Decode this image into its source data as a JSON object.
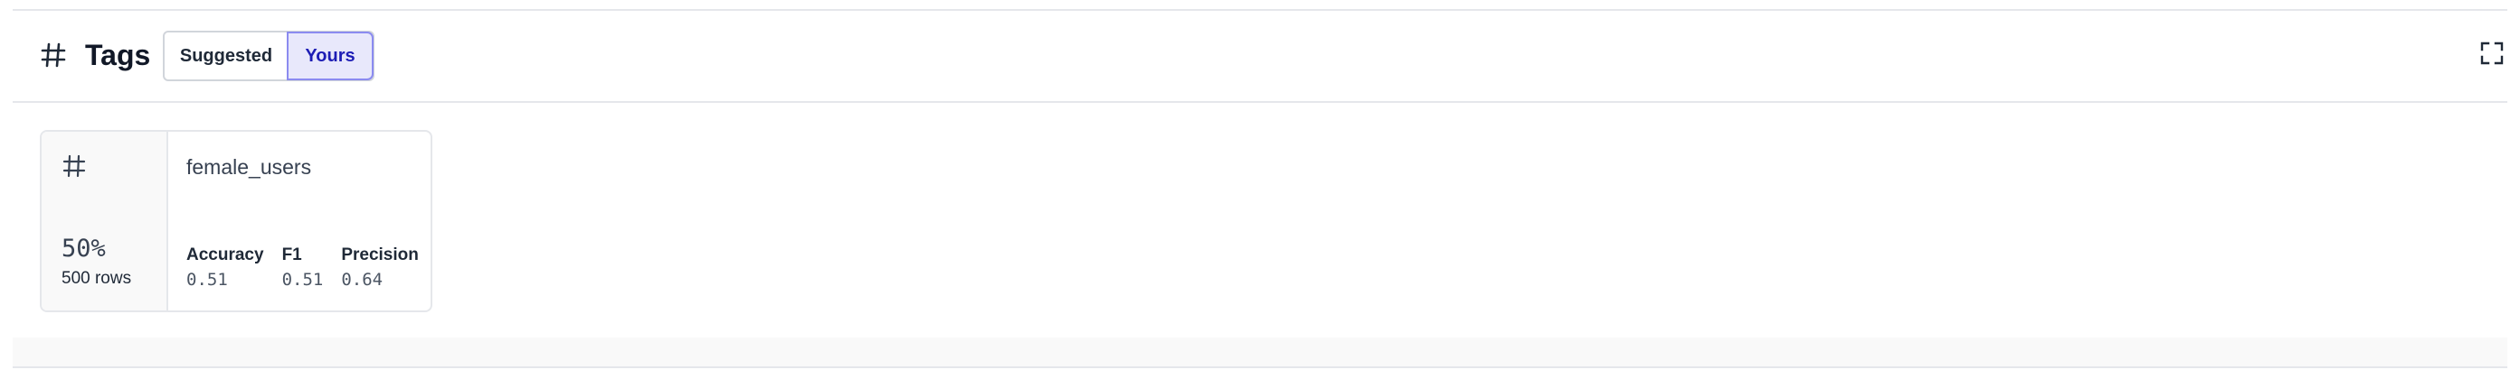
{
  "header": {
    "title": "Tags",
    "icon": "hash-icon",
    "expand_icon": "expand-icon"
  },
  "segmented_control": {
    "options": [
      "Suggested",
      "Yours"
    ],
    "selected": "Yours"
  },
  "card": {
    "icon": "hash-icon",
    "percentage": "50%",
    "rows": "500 rows",
    "tag_name": "female_users",
    "metrics": [
      {
        "label": "Accuracy",
        "value": "0.51"
      },
      {
        "label": "F1",
        "value": "0.51"
      },
      {
        "label": "Precision",
        "value": "0.64"
      }
    ]
  },
  "colors": {
    "accent": "#1d1db5",
    "accent_bg": "#e8e8fb",
    "border": "#e5e7eb"
  }
}
